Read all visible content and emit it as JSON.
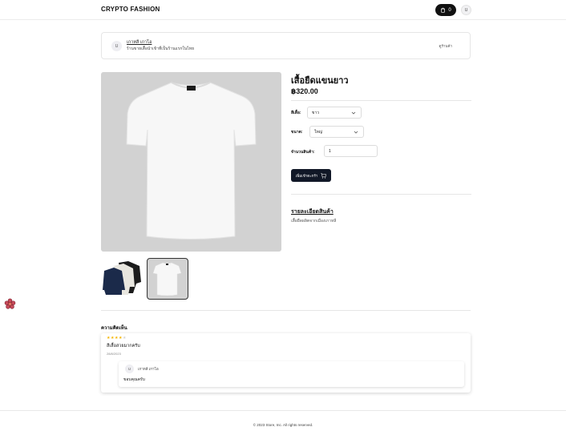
{
  "header": {
    "brand": "CRYPTO FASHION",
    "cart_count": "0",
    "avatar_initial": "U"
  },
  "seller": {
    "avatar_initial": "U",
    "name": "เกาหลี เกาโอ",
    "description": "ร้านขายเสื้อนำเข้าที่เป็นร้านแรกในไทย",
    "link_label": "ดูร้านค้า"
  },
  "product": {
    "title": "เสื้อยืดแขนยาว",
    "price": "฿320.00",
    "color_label": "สีเสื้อ:",
    "color_value": "ขาว",
    "size_label": "ขนาด:",
    "size_value": "ใหญ่",
    "qty_label": "จำนวนสินค้า:",
    "qty_value": "1",
    "add_to_cart_label": "เพิ่มเข้าตะกร้า",
    "details_title": "รายละเอียดสินค้า",
    "details_desc": "เสื้อยืดผลิตจากเมืองเกาหลี"
  },
  "reviews": {
    "title": "ความคิดเห็น",
    "rating": 4,
    "max_rating": 5,
    "text": "สีเสื้อสวยมากครับ",
    "date": "28/8/2023",
    "reply": {
      "avatar_initial": "U",
      "name": "เกาหลี เกาโอ",
      "text": "ขอบคุณครับ"
    }
  },
  "footer": {
    "copyright": "© 2023 Store, Inc. All rights reserved."
  },
  "colors": {
    "primary_dark": "#111827",
    "image_bg": "#d2d2d2",
    "star_on": "#f5b400",
    "star_off": "#d3d3d3"
  }
}
